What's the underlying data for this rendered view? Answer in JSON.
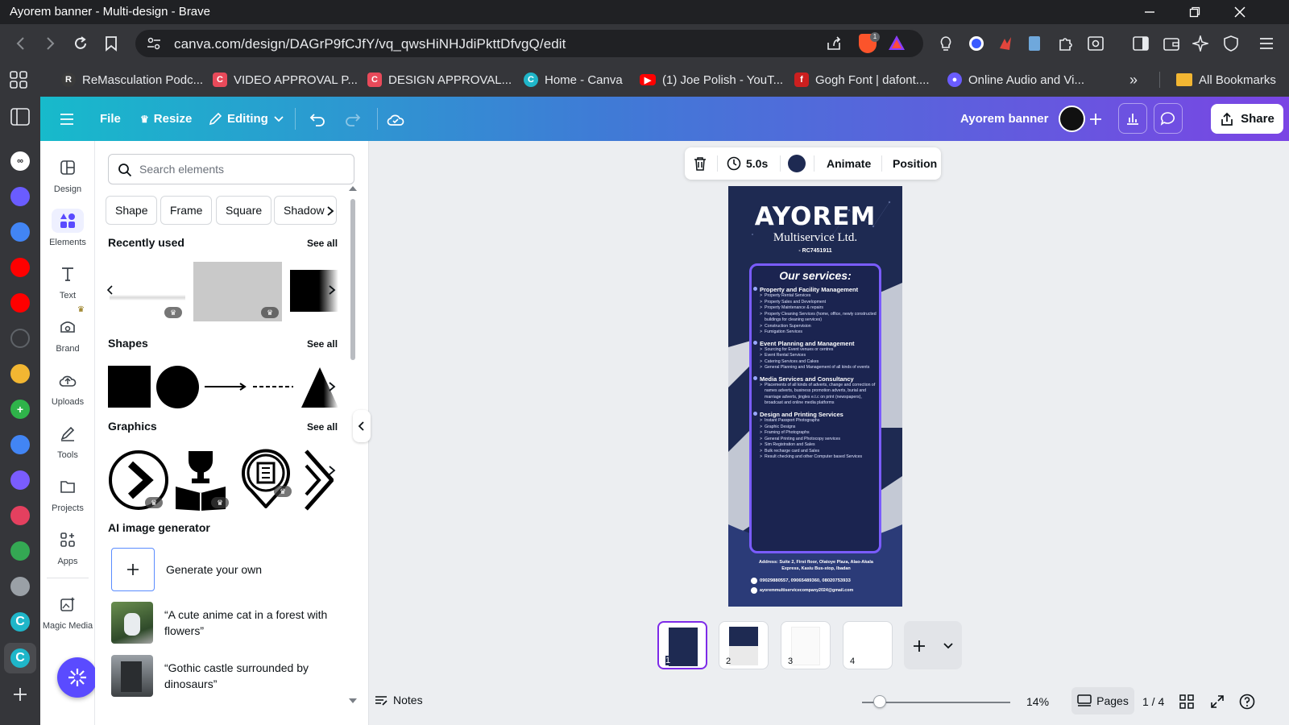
{
  "window": {
    "title": "Ayorem banner - Multi-design - Brave"
  },
  "browser": {
    "url": "canva.com/design/DAGrP9fCJfY/vq_qwsHiNHJdiPkttDfvgQ/edit",
    "bookmarks": [
      {
        "label": "ReMasculation Podc...",
        "icon": "podcast-icon",
        "color": "#3a3a3a"
      },
      {
        "label": "VIDEO APPROVAL P...",
        "icon": "form-icon",
        "color": "#e94a5a"
      },
      {
        "label": "DESIGN APPROVAL...",
        "icon": "form-icon",
        "color": "#e94a5a"
      },
      {
        "label": "Home - Canva",
        "icon": "canva-icon",
        "color": "#1fb6c9"
      },
      {
        "label": "(1) Joe Polish - YouT...",
        "icon": "youtube-icon",
        "color": "#ff0000"
      },
      {
        "label": "Gogh Font | dafont....",
        "icon": "dafont-icon",
        "color": "#cc1f1f"
      },
      {
        "label": "Online Audio and Vi...",
        "icon": "audio-icon",
        "color": "#6a5cff"
      }
    ],
    "all_bookmarks": "All Bookmarks",
    "more_bookmarks": "»"
  },
  "canva": {
    "header": {
      "file": "File",
      "resize": "Resize",
      "editing": "Editing",
      "doc_title": "Ayorem banner",
      "share": "Share"
    },
    "rail": [
      {
        "label": "Design",
        "icon": "design-icon"
      },
      {
        "label": "Elements",
        "icon": "elements-icon"
      },
      {
        "label": "Text",
        "icon": "text-icon"
      },
      {
        "label": "Brand",
        "icon": "brand-icon"
      },
      {
        "label": "Uploads",
        "icon": "uploads-icon"
      },
      {
        "label": "Tools",
        "icon": "tools-icon"
      },
      {
        "label": "Projects",
        "icon": "projects-icon"
      },
      {
        "label": "Apps",
        "icon": "apps-icon"
      },
      {
        "label": "Magic Media",
        "icon": "magic-media-icon"
      }
    ],
    "panel": {
      "search_placeholder": "Search elements",
      "chips": [
        "Shape",
        "Frame",
        "Square",
        "Shadow"
      ],
      "recently_used": "Recently used",
      "shapes": "Shapes",
      "graphics": "Graphics",
      "see_all": "See all",
      "ai_generator": "AI image generator",
      "generate_own": "Generate your own",
      "prompts": [
        "“A cute anime cat in a forest with flowers”",
        "“Gothic castle surrounded by dinosaurs”"
      ]
    },
    "toolbar": {
      "duration": "5.0s",
      "animate": "Animate",
      "position": "Position",
      "color": "#1e2a52"
    },
    "banner": {
      "brand": "AYOREM",
      "subtitle": "Multiservice Ltd.",
      "rc": "- RC7451911",
      "services_title": "Our services:",
      "services": [
        {
          "title": "Property and Facility Management",
          "items": [
            "Property Rental Services",
            "Property Sales and Development",
            "Property Maintenance & repairs",
            "Property Cleaning Services (home, office, newly constructed buildings for cleaning services)",
            "Construction Supervision",
            "Fumigation Services"
          ]
        },
        {
          "title": "Event Planning and Management",
          "items": [
            "Sourcing for Event venues or centres",
            "Event Rental Services",
            "Catering Services and Cakes",
            "General Planning and Management of all kinds of events"
          ]
        },
        {
          "title": "Media Services and Consultancy",
          "items": [
            "Placements of all kinds of adverts, change and correction of names adverts, business promotion adverts, burial and marriage adverts, jingles e.t.c on print (newspapers), broadcast and online media platforms"
          ]
        },
        {
          "title": "Design and Printing Services",
          "items": [
            "Instant Passport Photographs",
            "Graphic Designs",
            "Framing of Photographs",
            "General Printing and Photocopy services",
            "Sim Registration and Sales",
            "Bulk recharge card and Sales",
            "Result checking and other Computer based Services"
          ]
        }
      ],
      "address": "Address: Suite 2, First floor, Olatoye Plaza, Alao-Akala Express, Kasiu Bus-stop, Ibadan",
      "phones": "09029880557, 09065489360, 08020753933",
      "email": "ayoremmultiservicecompany2024@gmail.com"
    },
    "pages": [
      "1",
      "2",
      "3",
      "4"
    ],
    "footer": {
      "notes": "Notes",
      "zoom": "14%",
      "pages_label": "Pages",
      "page_count": "1 / 4"
    }
  }
}
